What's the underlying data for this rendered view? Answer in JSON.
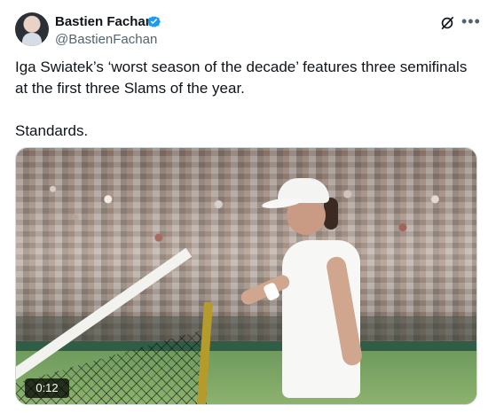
{
  "tweet": {
    "author_name": "Bastien Fachan",
    "author_handle": "@BastienFachan",
    "body": "Iga Swiatek’s ‘worst season of the decade’ features three semifinals at the first three Slams of the year.\n\nStandards.",
    "media": {
      "duration": "0:12"
    }
  },
  "icons": {
    "verified": "verified-badge-icon",
    "grok": "grok-icon",
    "more": "more-options-icon"
  },
  "colors": {
    "verified_blue": "#1d9bf0",
    "secondary_text": "#536471"
  }
}
